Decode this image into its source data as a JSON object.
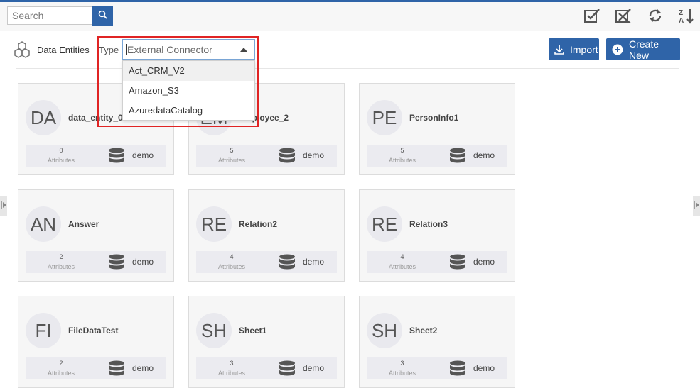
{
  "search": {
    "placeholder": "Search"
  },
  "toolbar": {
    "icons": [
      "check-all-icon",
      "uncheck-all-icon",
      "refresh-icon",
      "sort-za-icon"
    ]
  },
  "header": {
    "title": "Data Entities",
    "type_label": "Type",
    "type_value": "External Connector"
  },
  "dropdown": {
    "options": [
      "Act_CRM_V2",
      "Amazon_S3",
      "AzuredataCatalog"
    ]
  },
  "buttons": {
    "import": "Import",
    "create_new": "Create New"
  },
  "attributes_label": "Attributes",
  "cards": [
    {
      "initials": "DA",
      "name": "data_entity_0",
      "count": "0",
      "source": "demo"
    },
    {
      "initials": "EM",
      "name": "Employee_2",
      "count": "5",
      "source": "demo"
    },
    {
      "initials": "PE",
      "name": "PersonInfo1",
      "count": "5",
      "source": "demo"
    },
    {
      "initials": "AN",
      "name": "Answer",
      "count": "2",
      "source": "demo"
    },
    {
      "initials": "RE",
      "name": "Relation2",
      "count": "4",
      "source": "demo"
    },
    {
      "initials": "RE",
      "name": "Relation3",
      "count": "4",
      "source": "demo"
    },
    {
      "initials": "FI",
      "name": "FileDataTest",
      "count": "2",
      "source": "demo"
    },
    {
      "initials": "SH",
      "name": "Sheet1",
      "count": "3",
      "source": "demo"
    },
    {
      "initials": "SH",
      "name": "Sheet2",
      "count": "3",
      "source": "demo"
    }
  ],
  "colors": {
    "accent": "#2f64a8",
    "highlight": "#e02424"
  }
}
